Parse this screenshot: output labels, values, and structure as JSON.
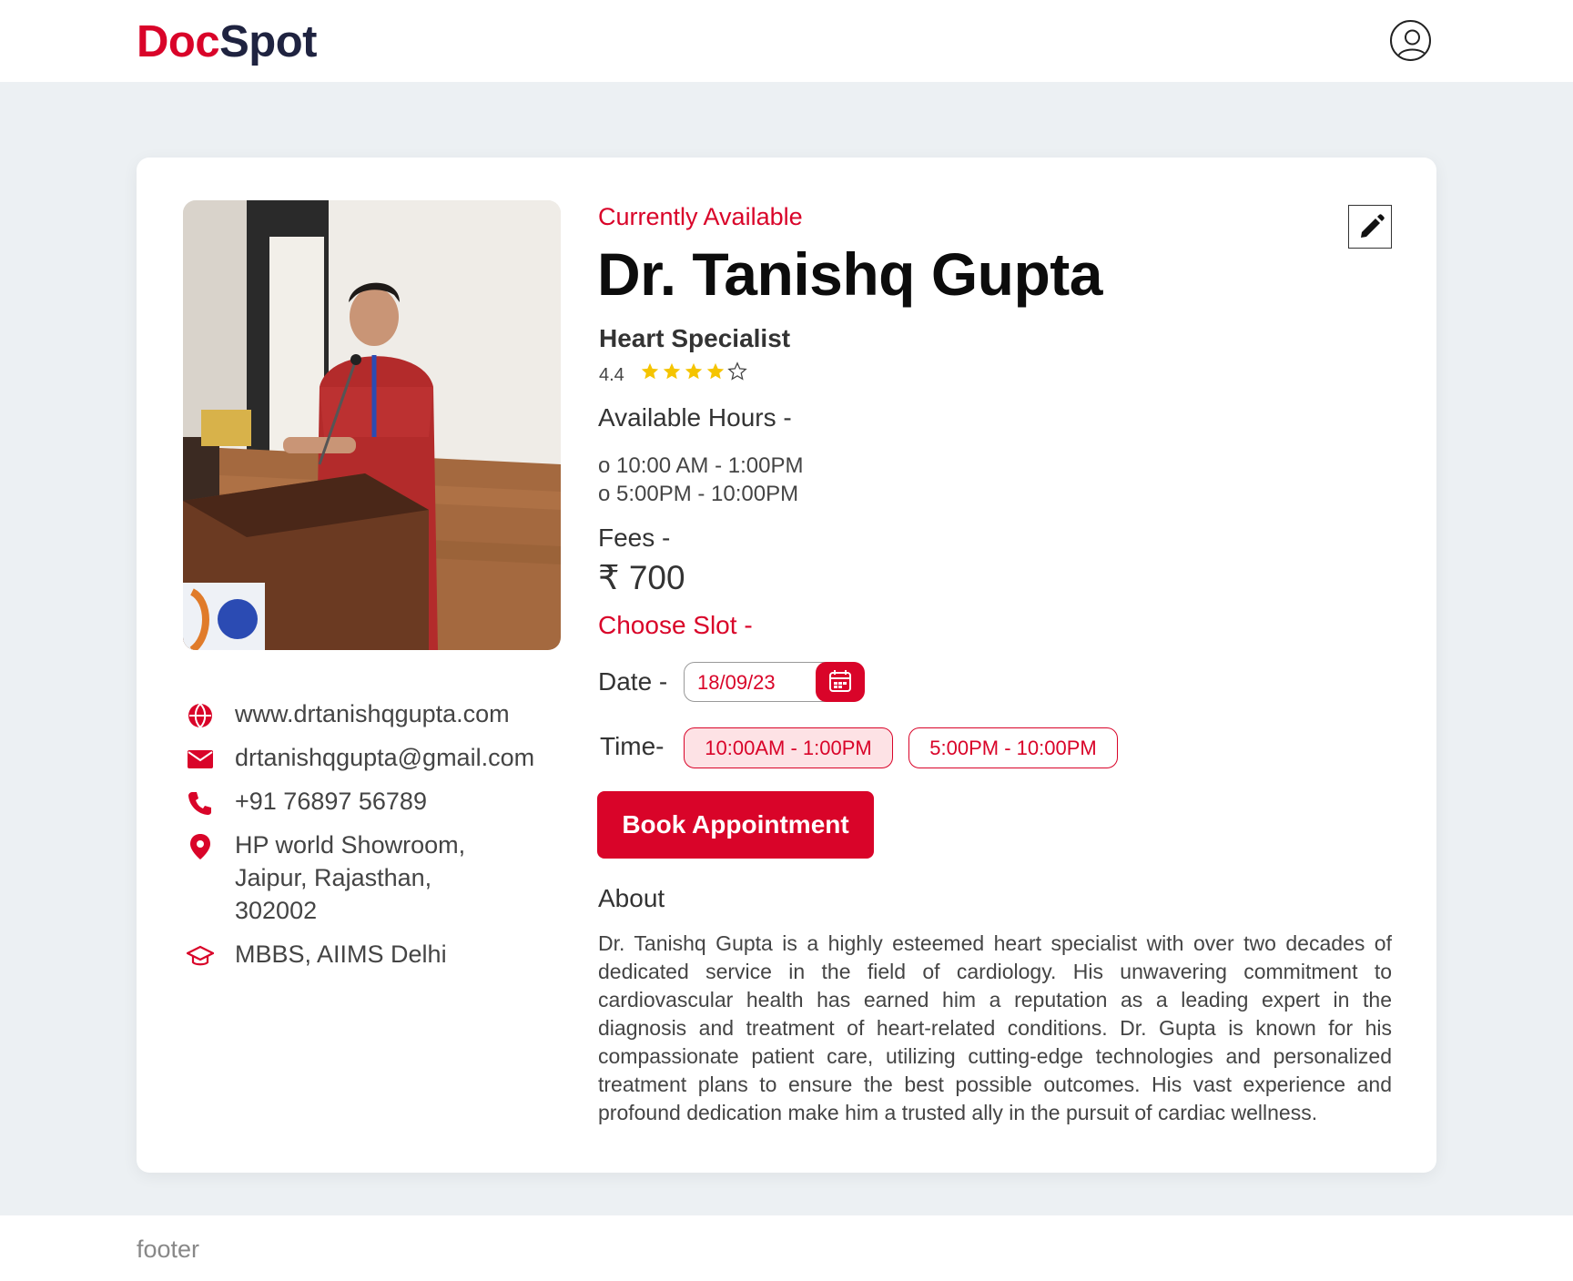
{
  "header": {
    "logo_part1": "Doc",
    "logo_part2": "Spot",
    "profile_icon": "user-circle-icon"
  },
  "doctor": {
    "status": "Currently Available",
    "name": "Dr. Tanishq Gupta",
    "specialty": "Heart Specialist",
    "rating": "4.4",
    "rating_stars": {
      "filled": 4,
      "total": 5
    },
    "available_hours_label": "Available Hours -",
    "hours": [
      "o 10:00 AM - 1:00PM",
      "o 5:00PM - 10:00PM"
    ],
    "fees_label": "Fees -",
    "fees": "₹ 700"
  },
  "contacts": {
    "website": "www.drtanishqgupta.com",
    "email": "drtanishqgupta@gmail.com",
    "phone": "+91 76897 56789",
    "address_line1": "HP world Showroom,",
    "address_line2": "Jaipur, Rajasthan,",
    "address_line3": "302002",
    "education": "MBBS, AIIMS Delhi"
  },
  "booking": {
    "choose_slot_label": "Choose Slot -",
    "date_label": "Date -",
    "date_value": "18/09/23",
    "time_label": "Time-",
    "slots": [
      "10:00AM - 1:00PM",
      "5:00PM - 10:00PM"
    ],
    "selected_slot": "10:00AM - 1:00PM",
    "book_label": "Book Appointment"
  },
  "about": {
    "title": "About",
    "text": "Dr. Tanishq Gupta is a highly esteemed heart specialist with over two decades of dedicated service in the field of cardiology. His unwavering commitment to cardiovascular health has earned him a reputation as a leading expert in the diagnosis and treatment of heart-related conditions. Dr. Gupta is known for his compassionate patient care, utilizing cutting-edge technologies and personalized treatment plans to ensure the best possible outcomes. His vast experience and profound dedication make him a trusted ally in the pursuit of cardiac wellness."
  },
  "footer": {
    "text": "footer"
  },
  "colors": {
    "accent": "#d90429",
    "logo_dark": "#1f2340",
    "background": "#ecf0f3",
    "star": "#f5c400"
  }
}
